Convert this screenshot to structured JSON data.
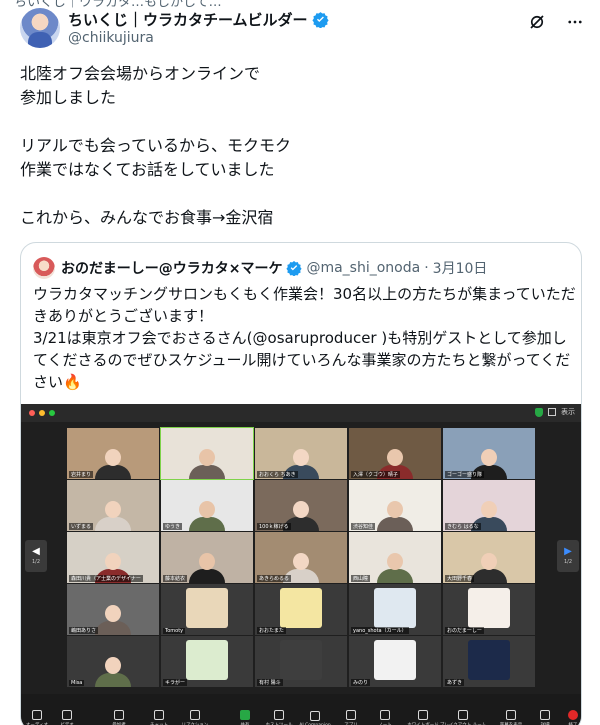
{
  "top_cut_text": "ちいくじ｜ウラカタ…もしかして…",
  "tweet": {
    "display_name": "ちいくじ｜ウラカタチームビルダー",
    "handle": "@chiikujiura",
    "text": "北陸オフ会会場からオンラインで\n参加しました\n\nリアルでも会っているから、モクモク\n作業ではなくてお話をしていました\n\nこれから、みんなでお食事→金沢宿"
  },
  "icons": {
    "verified": "verified-badge-icon",
    "grok": "grok-icon",
    "more": "more-icon"
  },
  "colors": {
    "verified": "#1d9bf0",
    "zoom_bg": "#1f1f1f",
    "active_speaker": "#7fd34a"
  },
  "quote": {
    "display_name": "おのだまーしー@ウラカタ×マーケ",
    "handle": "@ma_shi_onoda",
    "separator": "·",
    "date": "3月10日",
    "text": "ウラカタマッチングサロンもくもく作業会！30名以上の方たちが集まっていただきありがとうございます！\n3/21は東京オフ会でおさるさん(@osaruproducer )も特別ゲストとして参加してくださるのでぜひスケジュール開けていろんな事業家の方たちと繋がってください",
    "emoji": "🔥"
  },
  "zoom": {
    "view_label": "表示",
    "page_indicator": "1/2",
    "participants": [
      "岩井まり",
      "",
      "おおくら ちあき",
      "入澤（クゴウ）晴子",
      "ゴーゴー盛り隊",
      "いずまる",
      "ゆうき",
      "100ｋ稼げる",
      "渋谷知佳",
      "きむら はるな",
      "森田川貴（ア士業のデザイナー",
      "藤本結衣",
      "あきらめるる",
      "西山瞳",
      "大田野千春",
      "嶋田ありさ",
      "Tomoty",
      "おおたまた",
      "yano_shota（カール）",
      "おのだまーしー",
      "Misa",
      "キラがー",
      "有村 陽斗",
      "みのり",
      "あずき"
    ],
    "toolbar": [
      "オーディオ",
      "ビデオ",
      "参加者",
      "チャット",
      "リアクション",
      "共有",
      "ホストツール",
      "AI Companion",
      "アプリ",
      "ノート",
      "ホワイトボード",
      "ブレイクアウト ルーム",
      "字幕を表示",
      "詳細",
      "終了"
    ]
  }
}
